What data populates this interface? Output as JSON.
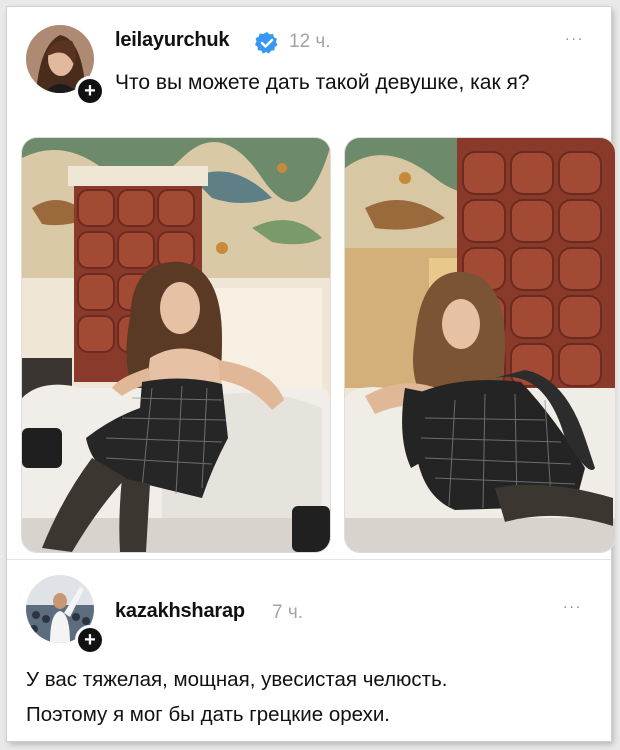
{
  "post": {
    "username": "leilayurchuk",
    "time": "12 ч.",
    "text": "Что вы можете дать такой девушке, как я?",
    "more": "...",
    "icons": [
      "avatar",
      "plus-icon",
      "verified-badge-icon",
      "more-icon"
    ]
  },
  "reply": {
    "username": "kazakhsharap",
    "time": "7 ч.",
    "more": "...",
    "text_line1": "У вас тяжелая, мощная, увесистая челюсть.",
    "text_line2": "Поэтому я мог бы дать грецкие орехи."
  },
  "colors": {
    "verified": "#3897f0",
    "muted": "#a4a4a4",
    "brick": "#8a3a2a"
  }
}
